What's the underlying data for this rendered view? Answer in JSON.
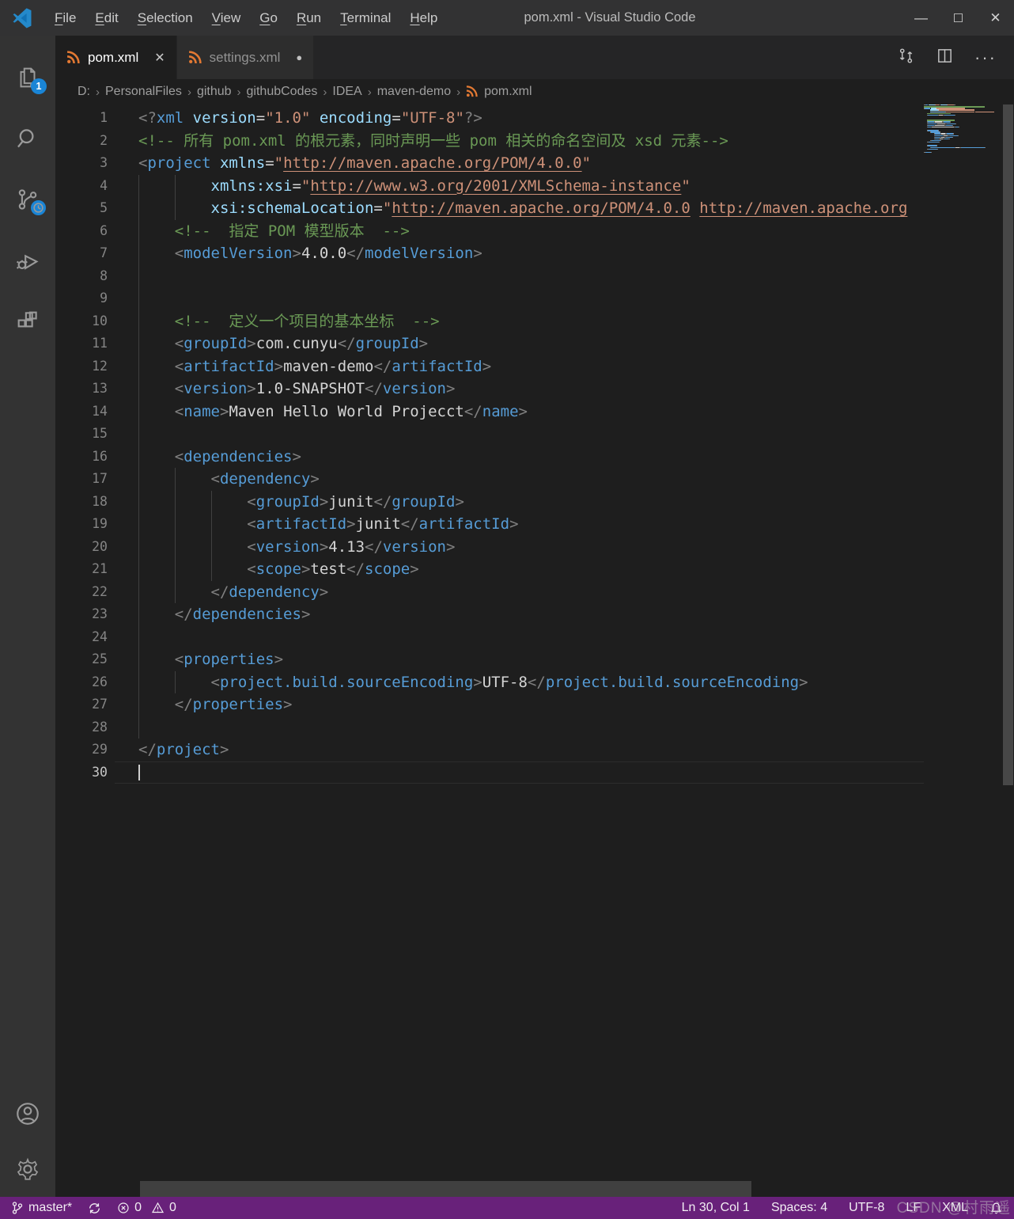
{
  "colors": {
    "titlebar_bg": "#323233",
    "activitybar_bg": "#333333",
    "tabbar_bg": "#252526",
    "editor_bg": "#1e1e1e",
    "statusbar_bg": "#68217a",
    "badge_blue": "#1a85d6",
    "xml_icon_orange": "#e37933",
    "token_tag": "#569cd6",
    "token_attr": "#9cdcfe",
    "token_string": "#ce9178",
    "token_text": "#d4d4d4",
    "token_comment": "#6a9955",
    "token_punct": "#808080"
  },
  "title_bar": {
    "title": "pom.xml - Visual Studio Code",
    "menus": [
      "File",
      "Edit",
      "Selection",
      "View",
      "Go",
      "Run",
      "Terminal",
      "Help"
    ],
    "window_controls": {
      "minimize": "—",
      "maximize": "☐",
      "close": "✕"
    }
  },
  "activity_bar": {
    "explorer_badge": "1",
    "icons": [
      "explorer",
      "search",
      "source-control",
      "run-and-debug",
      "extensions",
      "accounts",
      "settings-gear"
    ]
  },
  "tabs": [
    {
      "label": "pom.xml",
      "active": true,
      "dirty": false,
      "close_glyph": "✕"
    },
    {
      "label": "settings.xml",
      "active": false,
      "dirty": true,
      "dirty_glyph": "●"
    }
  ],
  "breadcrumb": [
    "D:",
    "PersonalFiles",
    "github",
    "githubCodes",
    "IDEA",
    "maven-demo",
    "pom.xml"
  ],
  "editor": {
    "cursor": {
      "line": 30,
      "col": 1
    },
    "lines": [
      {
        "num": 1,
        "tokens": [
          [
            "<?",
            "p"
          ],
          [
            "xml",
            "t"
          ],
          [
            " ",
            "x"
          ],
          [
            "version",
            "a"
          ],
          [
            "=",
            "x"
          ],
          [
            "\"1.0\"",
            "s"
          ],
          [
            " ",
            "x"
          ],
          [
            "encoding",
            "a"
          ],
          [
            "=",
            "x"
          ],
          [
            "\"UTF-8\"",
            "s"
          ],
          [
            "?>",
            "p"
          ]
        ]
      },
      {
        "num": 2,
        "tokens": [
          [
            "<!-- 所有 pom.xml 的根元素，同时声明一些 pom 相关的命名空间及 xsd 元素-->",
            "c"
          ]
        ]
      },
      {
        "num": 3,
        "tokens": [
          [
            "<",
            "p"
          ],
          [
            "project",
            "t"
          ],
          [
            " ",
            "x"
          ],
          [
            "xmlns",
            "a"
          ],
          [
            "=",
            "x"
          ],
          [
            "\"",
            "s"
          ],
          [
            "http://maven.apache.org/POM/4.0.0",
            "l"
          ],
          [
            "\"",
            "s"
          ]
        ]
      },
      {
        "num": 4,
        "tokens": [
          [
            "        ",
            "x"
          ],
          [
            "xmlns:xsi",
            "a"
          ],
          [
            "=",
            "x"
          ],
          [
            "\"",
            "s"
          ],
          [
            "http://www.w3.org/2001/XMLSchema-instance",
            "l"
          ],
          [
            "\"",
            "s"
          ]
        ]
      },
      {
        "num": 5,
        "tokens": [
          [
            "        ",
            "x"
          ],
          [
            "xsi:schemaLocation",
            "a"
          ],
          [
            "=",
            "x"
          ],
          [
            "\"",
            "s"
          ],
          [
            "http://maven.apache.org/POM/4.0.0",
            "l"
          ],
          [
            " ",
            "s"
          ],
          [
            "http://maven.apache.org",
            "l"
          ]
        ]
      },
      {
        "num": 6,
        "tokens": [
          [
            "    ",
            "x"
          ],
          [
            "<!--  指定 POM 模型版本  -->",
            "c"
          ]
        ]
      },
      {
        "num": 7,
        "tokens": [
          [
            "    ",
            "x"
          ],
          [
            "<",
            "p"
          ],
          [
            "modelVersion",
            "t"
          ],
          [
            ">",
            "p"
          ],
          [
            "4.0.0",
            "x"
          ],
          [
            "</",
            "p"
          ],
          [
            "modelVersion",
            "t"
          ],
          [
            ">",
            "p"
          ]
        ]
      },
      {
        "num": 8,
        "tokens": []
      },
      {
        "num": 9,
        "tokens": []
      },
      {
        "num": 10,
        "tokens": [
          [
            "    ",
            "x"
          ],
          [
            "<!--  定义一个项目的基本坐标  -->",
            "c"
          ]
        ]
      },
      {
        "num": 11,
        "tokens": [
          [
            "    ",
            "x"
          ],
          [
            "<",
            "p"
          ],
          [
            "groupId",
            "t"
          ],
          [
            ">",
            "p"
          ],
          [
            "com.cunyu",
            "x"
          ],
          [
            "</",
            "p"
          ],
          [
            "groupId",
            "t"
          ],
          [
            ">",
            "p"
          ]
        ]
      },
      {
        "num": 12,
        "tokens": [
          [
            "    ",
            "x"
          ],
          [
            "<",
            "p"
          ],
          [
            "artifactId",
            "t"
          ],
          [
            ">",
            "p"
          ],
          [
            "maven-demo",
            "x"
          ],
          [
            "</",
            "p"
          ],
          [
            "artifactId",
            "t"
          ],
          [
            ">",
            "p"
          ]
        ]
      },
      {
        "num": 13,
        "tokens": [
          [
            "    ",
            "x"
          ],
          [
            "<",
            "p"
          ],
          [
            "version",
            "t"
          ],
          [
            ">",
            "p"
          ],
          [
            "1.0-SNAPSHOT",
            "x"
          ],
          [
            "</",
            "p"
          ],
          [
            "version",
            "t"
          ],
          [
            ">",
            "p"
          ]
        ]
      },
      {
        "num": 14,
        "tokens": [
          [
            "    ",
            "x"
          ],
          [
            "<",
            "p"
          ],
          [
            "name",
            "t"
          ],
          [
            ">",
            "p"
          ],
          [
            "Maven Hello World Projecct",
            "x"
          ],
          [
            "</",
            "p"
          ],
          [
            "name",
            "t"
          ],
          [
            ">",
            "p"
          ]
        ]
      },
      {
        "num": 15,
        "tokens": []
      },
      {
        "num": 16,
        "tokens": [
          [
            "    ",
            "x"
          ],
          [
            "<",
            "p"
          ],
          [
            "dependencies",
            "t"
          ],
          [
            ">",
            "p"
          ]
        ]
      },
      {
        "num": 17,
        "tokens": [
          [
            "        ",
            "x"
          ],
          [
            "<",
            "p"
          ],
          [
            "dependency",
            "t"
          ],
          [
            ">",
            "p"
          ]
        ]
      },
      {
        "num": 18,
        "tokens": [
          [
            "            ",
            "x"
          ],
          [
            "<",
            "p"
          ],
          [
            "groupId",
            "t"
          ],
          [
            ">",
            "p"
          ],
          [
            "junit",
            "x"
          ],
          [
            "</",
            "p"
          ],
          [
            "groupId",
            "t"
          ],
          [
            ">",
            "p"
          ]
        ]
      },
      {
        "num": 19,
        "tokens": [
          [
            "            ",
            "x"
          ],
          [
            "<",
            "p"
          ],
          [
            "artifactId",
            "t"
          ],
          [
            ">",
            "p"
          ],
          [
            "junit",
            "x"
          ],
          [
            "</",
            "p"
          ],
          [
            "artifactId",
            "t"
          ],
          [
            ">",
            "p"
          ]
        ]
      },
      {
        "num": 20,
        "tokens": [
          [
            "            ",
            "x"
          ],
          [
            "<",
            "p"
          ],
          [
            "version",
            "t"
          ],
          [
            ">",
            "p"
          ],
          [
            "4.13",
            "x"
          ],
          [
            "</",
            "p"
          ],
          [
            "version",
            "t"
          ],
          [
            ">",
            "p"
          ]
        ]
      },
      {
        "num": 21,
        "tokens": [
          [
            "            ",
            "x"
          ],
          [
            "<",
            "p"
          ],
          [
            "scope",
            "t"
          ],
          [
            ">",
            "p"
          ],
          [
            "test",
            "x"
          ],
          [
            "</",
            "p"
          ],
          [
            "scope",
            "t"
          ],
          [
            ">",
            "p"
          ]
        ]
      },
      {
        "num": 22,
        "tokens": [
          [
            "        ",
            "x"
          ],
          [
            "</",
            "p"
          ],
          [
            "dependency",
            "t"
          ],
          [
            ">",
            "p"
          ]
        ]
      },
      {
        "num": 23,
        "tokens": [
          [
            "    ",
            "x"
          ],
          [
            "</",
            "p"
          ],
          [
            "dependencies",
            "t"
          ],
          [
            ">",
            "p"
          ]
        ]
      },
      {
        "num": 24,
        "tokens": []
      },
      {
        "num": 25,
        "tokens": [
          [
            "    ",
            "x"
          ],
          [
            "<",
            "p"
          ],
          [
            "properties",
            "t"
          ],
          [
            ">",
            "p"
          ]
        ]
      },
      {
        "num": 26,
        "tokens": [
          [
            "        ",
            "x"
          ],
          [
            "<",
            "p"
          ],
          [
            "project.build.sourceEncoding",
            "t"
          ],
          [
            ">",
            "p"
          ],
          [
            "UTF-8",
            "x"
          ],
          [
            "</",
            "p"
          ],
          [
            "project.build.sourceEncoding",
            "t"
          ],
          [
            ">",
            "p"
          ]
        ]
      },
      {
        "num": 27,
        "tokens": [
          [
            "    ",
            "x"
          ],
          [
            "</",
            "p"
          ],
          [
            "properties",
            "t"
          ],
          [
            ">",
            "p"
          ]
        ]
      },
      {
        "num": 28,
        "tokens": []
      },
      {
        "num": 29,
        "tokens": [
          [
            "</",
            "p"
          ],
          [
            "project",
            "t"
          ],
          [
            ">",
            "p"
          ]
        ]
      },
      {
        "num": 30,
        "tokens": []
      }
    ]
  },
  "status_bar": {
    "branch": "master*",
    "errors": "0",
    "warnings": "0",
    "line_col": "Ln 30, Col 1",
    "spaces": "Spaces: 4",
    "encoding": "UTF-8",
    "eol": "LF",
    "language": "XML"
  },
  "watermark": "CSDN @村雨遥"
}
